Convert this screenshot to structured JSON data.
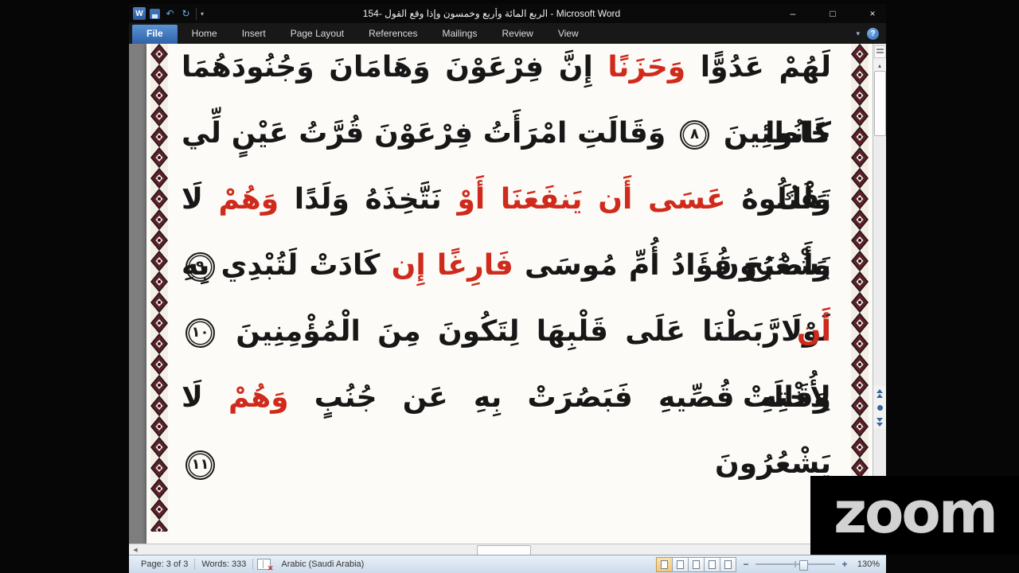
{
  "window": {
    "doc_title": "الربع المائة وأربع وخمسون وإذا وقع القول -154",
    "app_suffix": " - Microsoft Word",
    "controls": {
      "minimize": "–",
      "restore": "□",
      "close": "×"
    }
  },
  "quick_access": [
    {
      "name": "word-logo-icon",
      "glyph": "W"
    },
    {
      "name": "save-icon",
      "glyph": ""
    },
    {
      "name": "undo-icon",
      "glyph": "↶"
    },
    {
      "name": "redo-icon",
      "glyph": "↻"
    },
    {
      "name": "customize-toolbar-caret-icon",
      "glyph": "▾"
    }
  ],
  "ribbon": {
    "tabs": [
      {
        "label": "File",
        "active": true
      },
      {
        "label": "Home"
      },
      {
        "label": "Insert"
      },
      {
        "label": "Page Layout"
      },
      {
        "label": "References"
      },
      {
        "label": "Mailings"
      },
      {
        "label": "Review"
      },
      {
        "label": "View"
      }
    ],
    "collapse_glyph": "▾",
    "help_glyph": "?"
  },
  "document": {
    "lines": [
      {
        "segments": [
          {
            "text": "لَهُمْ عَدُوًّا ",
            "color": "black"
          },
          {
            "text": "وَحَزَنًا",
            "color": "red"
          },
          {
            "text": " إِنَّ فِرْعَوْنَ وَهَامَانَ وَجُنُودَهُمَا كَانُوا",
            "color": "black"
          }
        ]
      },
      {
        "segments": [
          {
            "text": "خَاطِئِينَ ",
            "color": "black"
          },
          {
            "verse": "٨"
          },
          {
            "text": " وَقَالَتِ امْرَأَتُ فِرْعَوْنَ قُرَّتُ عَيْنٍ لِّي وَلَكَ لَا",
            "color": "black"
          }
        ]
      },
      {
        "segments": [
          {
            "text": "تَقْتُلُوهُ ",
            "color": "black"
          },
          {
            "text": "عَسَى أَن يَنفَعَنَا أَوْ",
            "color": "red"
          },
          {
            "text": " نَتَّخِذَهُ وَلَدًا ",
            "color": "black"
          },
          {
            "text": "وَهُمْ",
            "color": "red"
          },
          {
            "text": " لَا يَشْعُرُونَ ",
            "color": "black"
          },
          {
            "verse": "٩"
          }
        ]
      },
      {
        "segments": [
          {
            "text": "وَأَصْبَحَ فُؤَادُ أُمِّ مُوسَى ",
            "color": "black"
          },
          {
            "text": "فَارِغًا إِن",
            "color": "red"
          },
          {
            "text": " كَادَتْ لَتُبْدِي بِهِ لَوْلَا",
            "color": "black"
          }
        ]
      },
      {
        "segments": [
          {
            "text": "أَن",
            "color": "red"
          },
          {
            "text": " رَّبَطْنَا عَلَى قَلْبِهَا لِتَكُونَ مِنَ الْمُؤْمِنِينَ ",
            "color": "black"
          },
          {
            "verse": "١٠"
          },
          {
            "text": " وَقَالَتْ",
            "color": "black"
          }
        ]
      },
      {
        "segments": [
          {
            "text": "لِأُخْتِهِ قُصِّيهِ فَبَصُرَتْ بِهِ عَن جُنُبٍ ",
            "color": "black"
          },
          {
            "text": "وَهُمْ",
            "color": "red"
          },
          {
            "text": " لَا يَشْعُرُونَ ",
            "color": "black"
          },
          {
            "verse": "١١"
          }
        ]
      }
    ]
  },
  "status_bar": {
    "page": "Page: 3 of 3",
    "words": "Words: 333",
    "language": "Arabic (Saudi Arabia)",
    "zoom_level": "130%",
    "view_buttons": [
      {
        "name": "print-layout-view-button",
        "active": true
      },
      {
        "name": "full-screen-reading-view-button"
      },
      {
        "name": "web-layout-view-button"
      },
      {
        "name": "outline-view-button"
      },
      {
        "name": "draft-view-button"
      }
    ]
  },
  "icons": {
    "scroll_up": "▲",
    "scroll_down": "▼",
    "scroll_left": "◀",
    "scroll_right": "▶",
    "zoom_out": "−",
    "zoom_in": "+",
    "proofing_error": "✕"
  },
  "watermark": "zoom",
  "colors": {
    "tajweed_red": "#cf2a1b",
    "ornament_maroon": "#5d1f2a",
    "file_tab_blue": "#2f62a8"
  }
}
